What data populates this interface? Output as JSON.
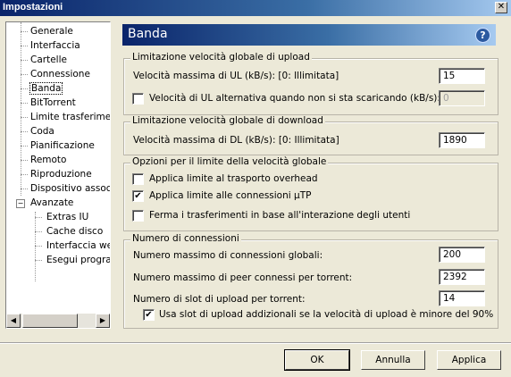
{
  "window": {
    "title": "Impostazioni",
    "close_glyph": "✕"
  },
  "tree": {
    "items": [
      {
        "label": "Generale"
      },
      {
        "label": "Interfaccia"
      },
      {
        "label": "Cartelle"
      },
      {
        "label": "Connessione"
      },
      {
        "label": "Banda"
      },
      {
        "label": "BitTorrent"
      },
      {
        "label": "Limite trasferimenti"
      },
      {
        "label": "Coda"
      },
      {
        "label": "Pianificazione"
      },
      {
        "label": "Remoto"
      },
      {
        "label": "Riproduzione"
      },
      {
        "label": "Dispositivo associato"
      },
      {
        "label": "Avanzate"
      },
      {
        "label": "Extras IU"
      },
      {
        "label": "Cache disco"
      },
      {
        "label": "Interfaccia web"
      },
      {
        "label": "Esegui programma"
      }
    ],
    "expander_glyph": "−",
    "scroll_left": "◀",
    "scroll_right": "▶"
  },
  "header": {
    "title": "Banda",
    "help": "?"
  },
  "upload": {
    "legend": "Limitazione velocità globale di upload",
    "max_label": "Velocità massima di UL (kB/s): [0: Illimitata]",
    "max_value": "15",
    "alt_label": "Velocità di UL alternativa quando non si sta scaricando (kB/s):",
    "alt_checked": false,
    "alt_value": "0"
  },
  "download": {
    "legend": "Limitazione velocità globale di download",
    "max_label": "Velocità massima di DL (kB/s): [0: Illimitata]",
    "max_value": "1890"
  },
  "options": {
    "legend": "Opzioni per il limite della velocità globale",
    "items": [
      {
        "label": "Applica limite al trasporto overhead",
        "checked": false
      },
      {
        "label": "Applica limite alle connessioni µTP",
        "checked": true
      },
      {
        "label": "Ferma i trasferimenti in base all'interazione degli utenti",
        "checked": false
      }
    ]
  },
  "connections": {
    "legend": "Numero di connessioni",
    "global_label": "Numero massimo di connessioni globali:",
    "global_value": "200",
    "peer_label": "Numero massimo di peer connessi per torrent:",
    "peer_value": "2392",
    "slots_label": "Numero di slot di upload per torrent:",
    "slots_value": "14",
    "extra_label": "Usa slot di upload addizionali se la velocità di upload è minore del 90%",
    "extra_checked": true
  },
  "buttons": {
    "ok": "OK",
    "cancel": "Annulla",
    "apply": "Applica"
  },
  "check_glyph": "✔"
}
